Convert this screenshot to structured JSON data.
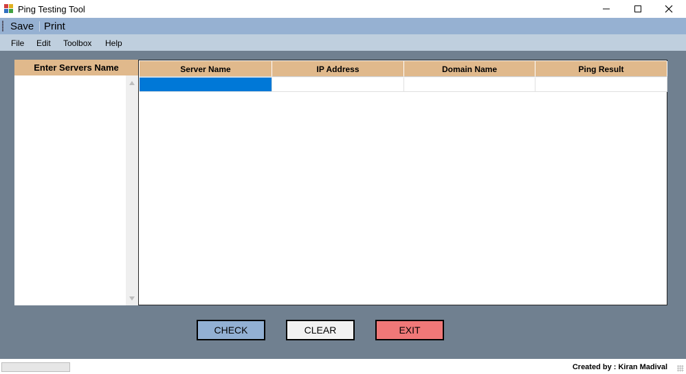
{
  "window": {
    "title": "Ping Testing Tool",
    "controls": [
      "minimize-icon",
      "maximize-icon",
      "close-icon"
    ]
  },
  "toolbar": {
    "save_label": "Save",
    "print_label": "Print"
  },
  "menu": {
    "items": [
      {
        "label": "File"
      },
      {
        "label": "Edit"
      },
      {
        "label": "Toolbox"
      },
      {
        "label": "Help"
      }
    ]
  },
  "servers_panel": {
    "header": "Enter Servers Name",
    "value": ""
  },
  "results_grid": {
    "columns": [
      "Server Name",
      "IP Address",
      "Domain Name",
      "Ping Result"
    ],
    "rows": [
      [
        "",
        "",
        "",
        ""
      ]
    ],
    "selected_cell": "row-1-server-name"
  },
  "buttons": {
    "check": "CHECK",
    "clear": "CLEAR",
    "exit": "EXIT"
  },
  "status": {
    "credit": "Created by : Kiran Madival"
  },
  "colors": {
    "background": "#708090",
    "toolstrip": "#96b1d2",
    "menubar": "#bfcfde",
    "grid_header": "#e0b98c",
    "check_button": "#92b0d3",
    "clear_button": "#f2f2f2",
    "exit_button": "#f07878",
    "selection": "#0078d7"
  }
}
